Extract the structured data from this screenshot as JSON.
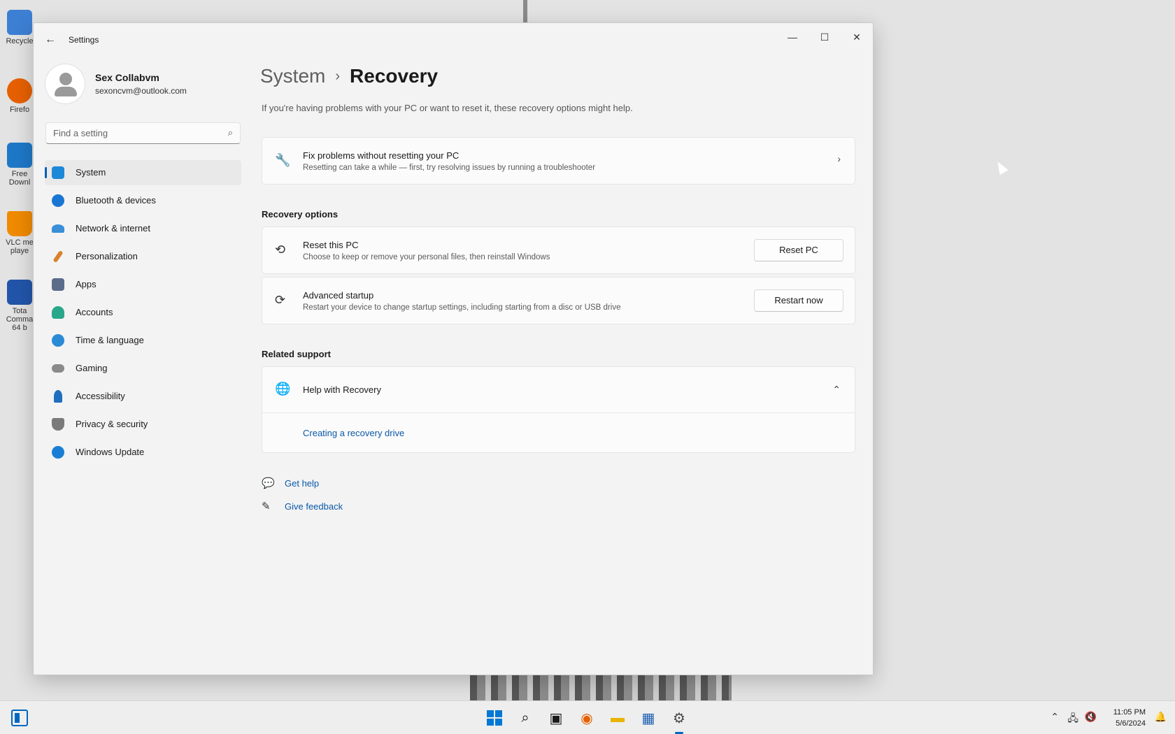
{
  "desktop": {
    "icons": [
      {
        "label": "Recycle",
        "color": "#3d7fd3"
      },
      {
        "label": "Firefo",
        "color": "#e66000"
      },
      {
        "label": "Free Downl",
        "color": "#1e78c8"
      },
      {
        "label": "VLC me playe",
        "color": "#f08a00"
      },
      {
        "label": "Tota Comma 64 b",
        "color": "#2255aa"
      }
    ]
  },
  "window": {
    "app_title": "Settings",
    "back_icon": "←",
    "min_icon": "—",
    "max_icon": "☐",
    "close_icon": "✕"
  },
  "user": {
    "name": "Sex Collabvm",
    "email": "sexoncvm@outlook.com"
  },
  "search": {
    "placeholder": "Find a setting",
    "icon": "⌕"
  },
  "sidebar": {
    "items": [
      {
        "label": "System",
        "color": "#1e88d8"
      },
      {
        "label": "Bluetooth & devices",
        "color": "#1976d2"
      },
      {
        "label": "Network & internet",
        "color": "#3a8fd8"
      },
      {
        "label": "Personalization",
        "color": "#d9822b"
      },
      {
        "label": "Apps",
        "color": "#5b6b8a"
      },
      {
        "label": "Accounts",
        "color": "#2aa78a"
      },
      {
        "label": "Time & language",
        "color": "#2a8ad6"
      },
      {
        "label": "Gaming",
        "color": "#8a8a8a"
      },
      {
        "label": "Accessibility",
        "color": "#1f6fbf"
      },
      {
        "label": "Privacy & security",
        "color": "#7a7a7a"
      },
      {
        "label": "Windows Update",
        "color": "#1a7fd4"
      }
    ]
  },
  "breadcrumb": {
    "root": "System",
    "separator": "›",
    "current": "Recovery"
  },
  "intro": "If you're having problems with your PC or want to reset it, these recovery options might help.",
  "fix_card": {
    "icon": "🔧",
    "title": "Fix problems without resetting your PC",
    "desc": "Resetting can take a while — first, try resolving issues by running a troubleshooter",
    "chevron": "›"
  },
  "recovery_options": {
    "heading": "Recovery options",
    "reset": {
      "icon": "⟲",
      "title": "Reset this PC",
      "desc": "Choose to keep or remove your personal files, then reinstall Windows",
      "button": "Reset PC"
    },
    "advanced": {
      "icon": "⟳",
      "title": "Advanced startup",
      "desc": "Restart your device to change startup settings, including starting from a disc or USB drive",
      "button": "Restart now"
    }
  },
  "related_support": {
    "heading": "Related support",
    "help": {
      "icon": "🌐",
      "title": "Help with Recovery",
      "chevron": "⌃",
      "link": "Creating a recovery drive"
    }
  },
  "footer_links": {
    "get_help": "Get help",
    "give_feedback": "Give feedback",
    "help_icon": "💬",
    "feedback_icon": "✎"
  },
  "taskbar": {
    "start_icon": "windows-logo",
    "search_icon": "⌕",
    "taskview_icon": "▣",
    "firefox_icon": "◉",
    "explorer_icon": "▬",
    "store_icon": "▦",
    "settings_icon": "⚙",
    "tray_chevron": "⌃",
    "network_icon": "🖧",
    "volume_icon": "🔇",
    "notification_icon": "🔔",
    "time": "11:05 PM",
    "date": "5/6/2024"
  }
}
